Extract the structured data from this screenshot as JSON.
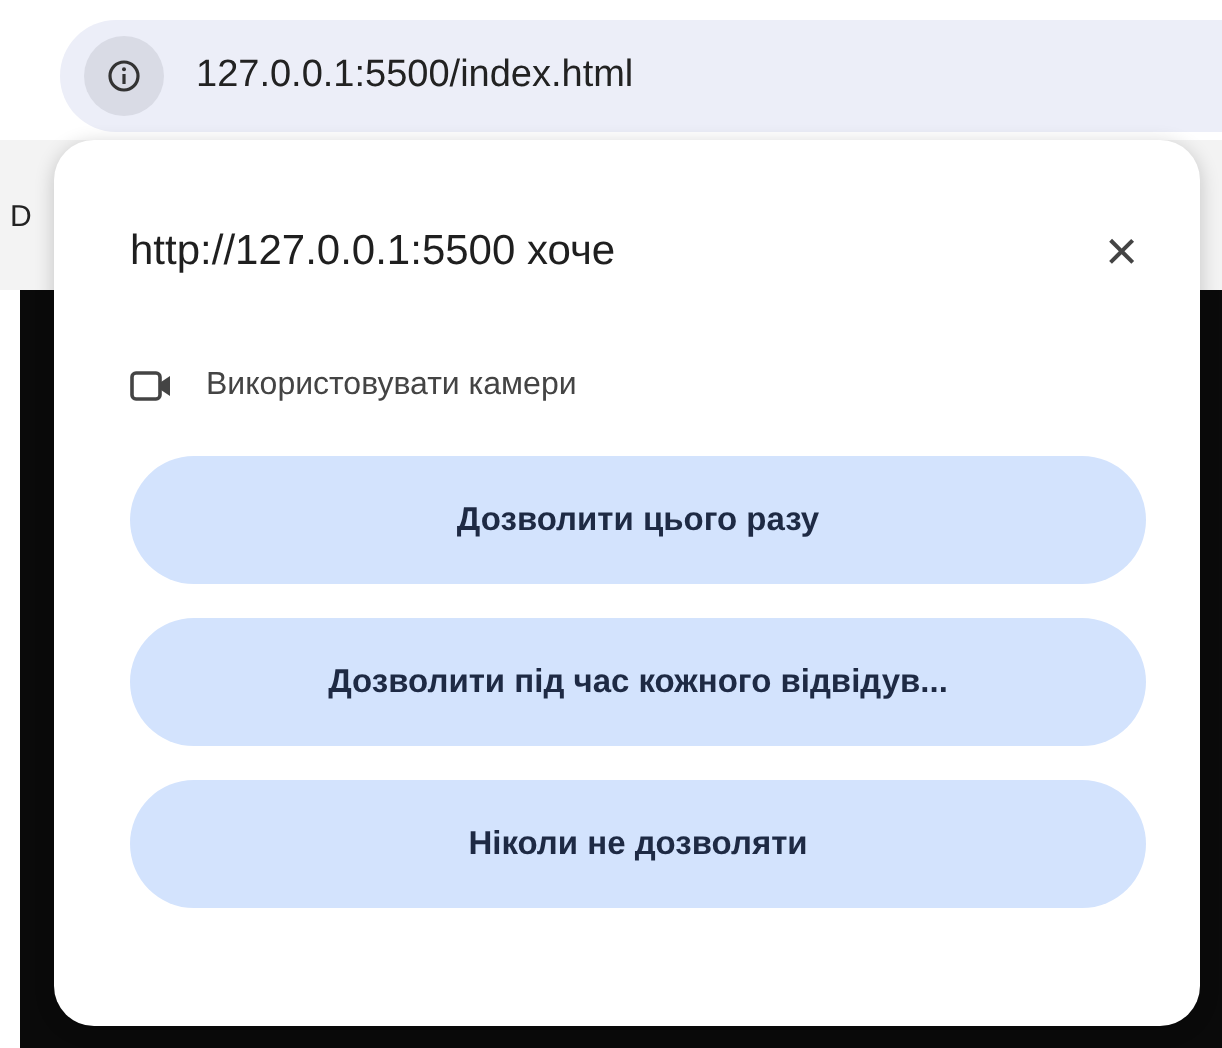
{
  "address_bar": {
    "url": "127.0.0.1:5500/index.html"
  },
  "page": {
    "cut_text": "D"
  },
  "permission_popup": {
    "title": "http://127.0.0.1:5500 хоче",
    "close": "×",
    "permission": "Використовувати камери",
    "buttons": [
      {
        "label": "Дозволити цього разу"
      },
      {
        "label": "Дозволити під час кожного відвідув..."
      },
      {
        "label": "Ніколи не дозволяти"
      }
    ]
  }
}
